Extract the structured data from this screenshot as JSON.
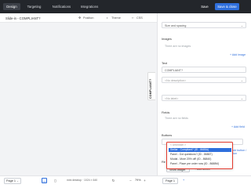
{
  "tabs": [
    "Design",
    "Targeting",
    "Notifications",
    "Integrations"
  ],
  "active_tab": "Design",
  "toolbar": {
    "save_label": "Save",
    "save_close_label": "Save & close"
  },
  "canvas": {
    "breadcrumb": "Slide-in - COMPLIANT?",
    "chips": {
      "position": "Position",
      "theme": "Theme",
      "css": "CSS"
    },
    "vertical_tab": "COMPLIANT?"
  },
  "panel": {
    "size_spacing": "Size and spacing",
    "images_title": "Images",
    "images_empty": "There are no images",
    "add_image": "+ Add image",
    "text_title": "Text",
    "text_value": "COMPLIANT?",
    "no_description": "<No description>",
    "no_label": "<No label>",
    "fields_title": "Fields",
    "fields_empty": "There are no fields",
    "add_field": "+ Add field",
    "buttons_title": "Buttons",
    "action_link": "+ Add button / Action",
    "re_label": "Re",
    "show_widget": "Show widget",
    "add_action": "+ Add action",
    "dropdown": {
      "hint": "< Unknown >",
      "options": [
        "Stellar - Compliant? (ID - 8685A)",
        "Panel - Got questions? (ID - 8686T)",
        "Modal - More 20% off! (ID - 86840)",
        "Panel - Place pre order now (ID - 8688M)"
      ],
      "selected_index": 0
    }
  },
  "bottom": {
    "page_select": "Page 1",
    "desktop_label": "mini desktop · 1024 × 640",
    "zoom": "79%",
    "page_right": "Page 1"
  }
}
